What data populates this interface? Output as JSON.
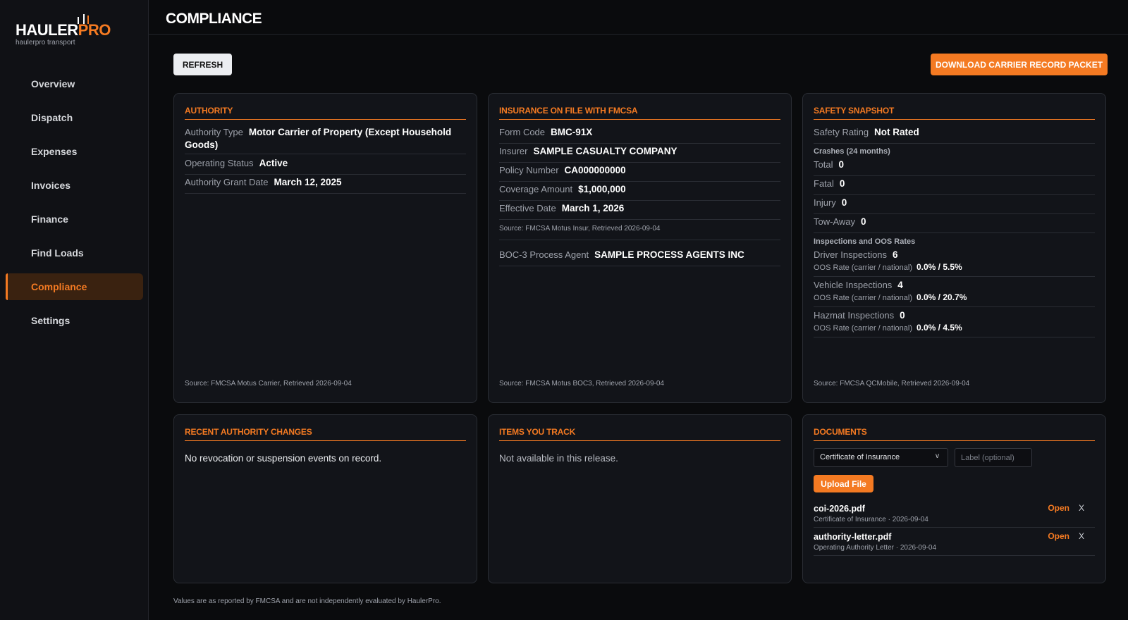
{
  "brand": {
    "word_a": "HAULER",
    "word_b": "PRO",
    "sub": "haulerpro transport",
    "truck_icon": "truck-icon"
  },
  "sidebar": {
    "items": [
      {
        "label": "Overview"
      },
      {
        "label": "Dispatch"
      },
      {
        "label": "Expenses"
      },
      {
        "label": "Invoices"
      },
      {
        "label": "Finance"
      },
      {
        "label": "Find Loads"
      },
      {
        "label": "Compliance",
        "active": true
      },
      {
        "label": "Settings"
      }
    ]
  },
  "header": {
    "title": "COMPLIANCE"
  },
  "toolbar": {
    "refresh_label": "REFRESH",
    "download_label": "DOWNLOAD CARRIER RECORD PACKET"
  },
  "authority": {
    "title": "AUTHORITY",
    "rows": [
      {
        "label": "Authority Type",
        "value": "Motor Carrier of Property (Except Household Goods)"
      },
      {
        "label": "Operating Status",
        "value": "Active"
      },
      {
        "label": "Authority Grant Date",
        "value": "March 12, 2025"
      }
    ],
    "source": "Source: FMCSA Motus Carrier, Retrieved 2026-09-04"
  },
  "insurance": {
    "title": "INSURANCE ON FILE WITH FMCSA",
    "rows": [
      {
        "label": "Form Code",
        "value": "BMC-91X"
      },
      {
        "label": "Insurer",
        "value": "SAMPLE CASUALTY COMPANY"
      },
      {
        "label": "Policy Number",
        "value": "CA000000000"
      },
      {
        "label": "Coverage Amount",
        "value": "$1,000,000"
      },
      {
        "label": "Effective Date",
        "value": "March 1, 2026"
      }
    ],
    "insur_source": "Source: FMCSA Motus Insur, Retrieved 2026-09-04",
    "boc3": {
      "label": "BOC-3 Process Agent",
      "value": "SAMPLE PROCESS AGENTS INC"
    },
    "source": "Source: FMCSA Motus BOC3, Retrieved 2026-09-04"
  },
  "safety": {
    "title": "SAFETY SNAPSHOT",
    "rating": {
      "label": "Safety Rating",
      "value": "Not Rated"
    },
    "crashes_head": "Crashes (24 months)",
    "crashes": [
      {
        "label": "Total",
        "value": "0"
      },
      {
        "label": "Fatal",
        "value": "0"
      },
      {
        "label": "Injury",
        "value": "0"
      },
      {
        "label": "Tow-Away",
        "value": "0"
      }
    ],
    "insp_head": "Inspections and OOS Rates",
    "oos_label": "OOS Rate (carrier / national)",
    "inspections": [
      {
        "label": "Driver Inspections",
        "value": "6",
        "oos": "0.0% / 5.5%"
      },
      {
        "label": "Vehicle Inspections",
        "value": "4",
        "oos": "0.0% / 20.7%"
      },
      {
        "label": "Hazmat Inspections",
        "value": "0",
        "oos": "0.0% / 4.5%"
      }
    ],
    "source": "Source: FMCSA QCMobile, Retrieved 2026-09-04"
  },
  "changes": {
    "title": "RECENT AUTHORITY CHANGES",
    "text": "No revocation or suspension events on record."
  },
  "tracked": {
    "title": "ITEMS YOU TRACK",
    "text": "Not available in this release."
  },
  "documents": {
    "title": "DOCUMENTS",
    "type_selected": "Certificate of Insurance",
    "label_placeholder": "Label (optional)",
    "upload_label": "Upload File",
    "open_label": "Open",
    "delete_label": "X",
    "files": [
      {
        "name": "coi-2026.pdf",
        "type": "Certificate of Insurance",
        "date": "2026-09-04"
      },
      {
        "name": "authority-letter.pdf",
        "type": "Operating Authority Letter",
        "date": "2026-09-04"
      }
    ]
  },
  "footer": {
    "note": "Values are as reported by FMCSA and are not independently evaluated by HaulerPro."
  }
}
